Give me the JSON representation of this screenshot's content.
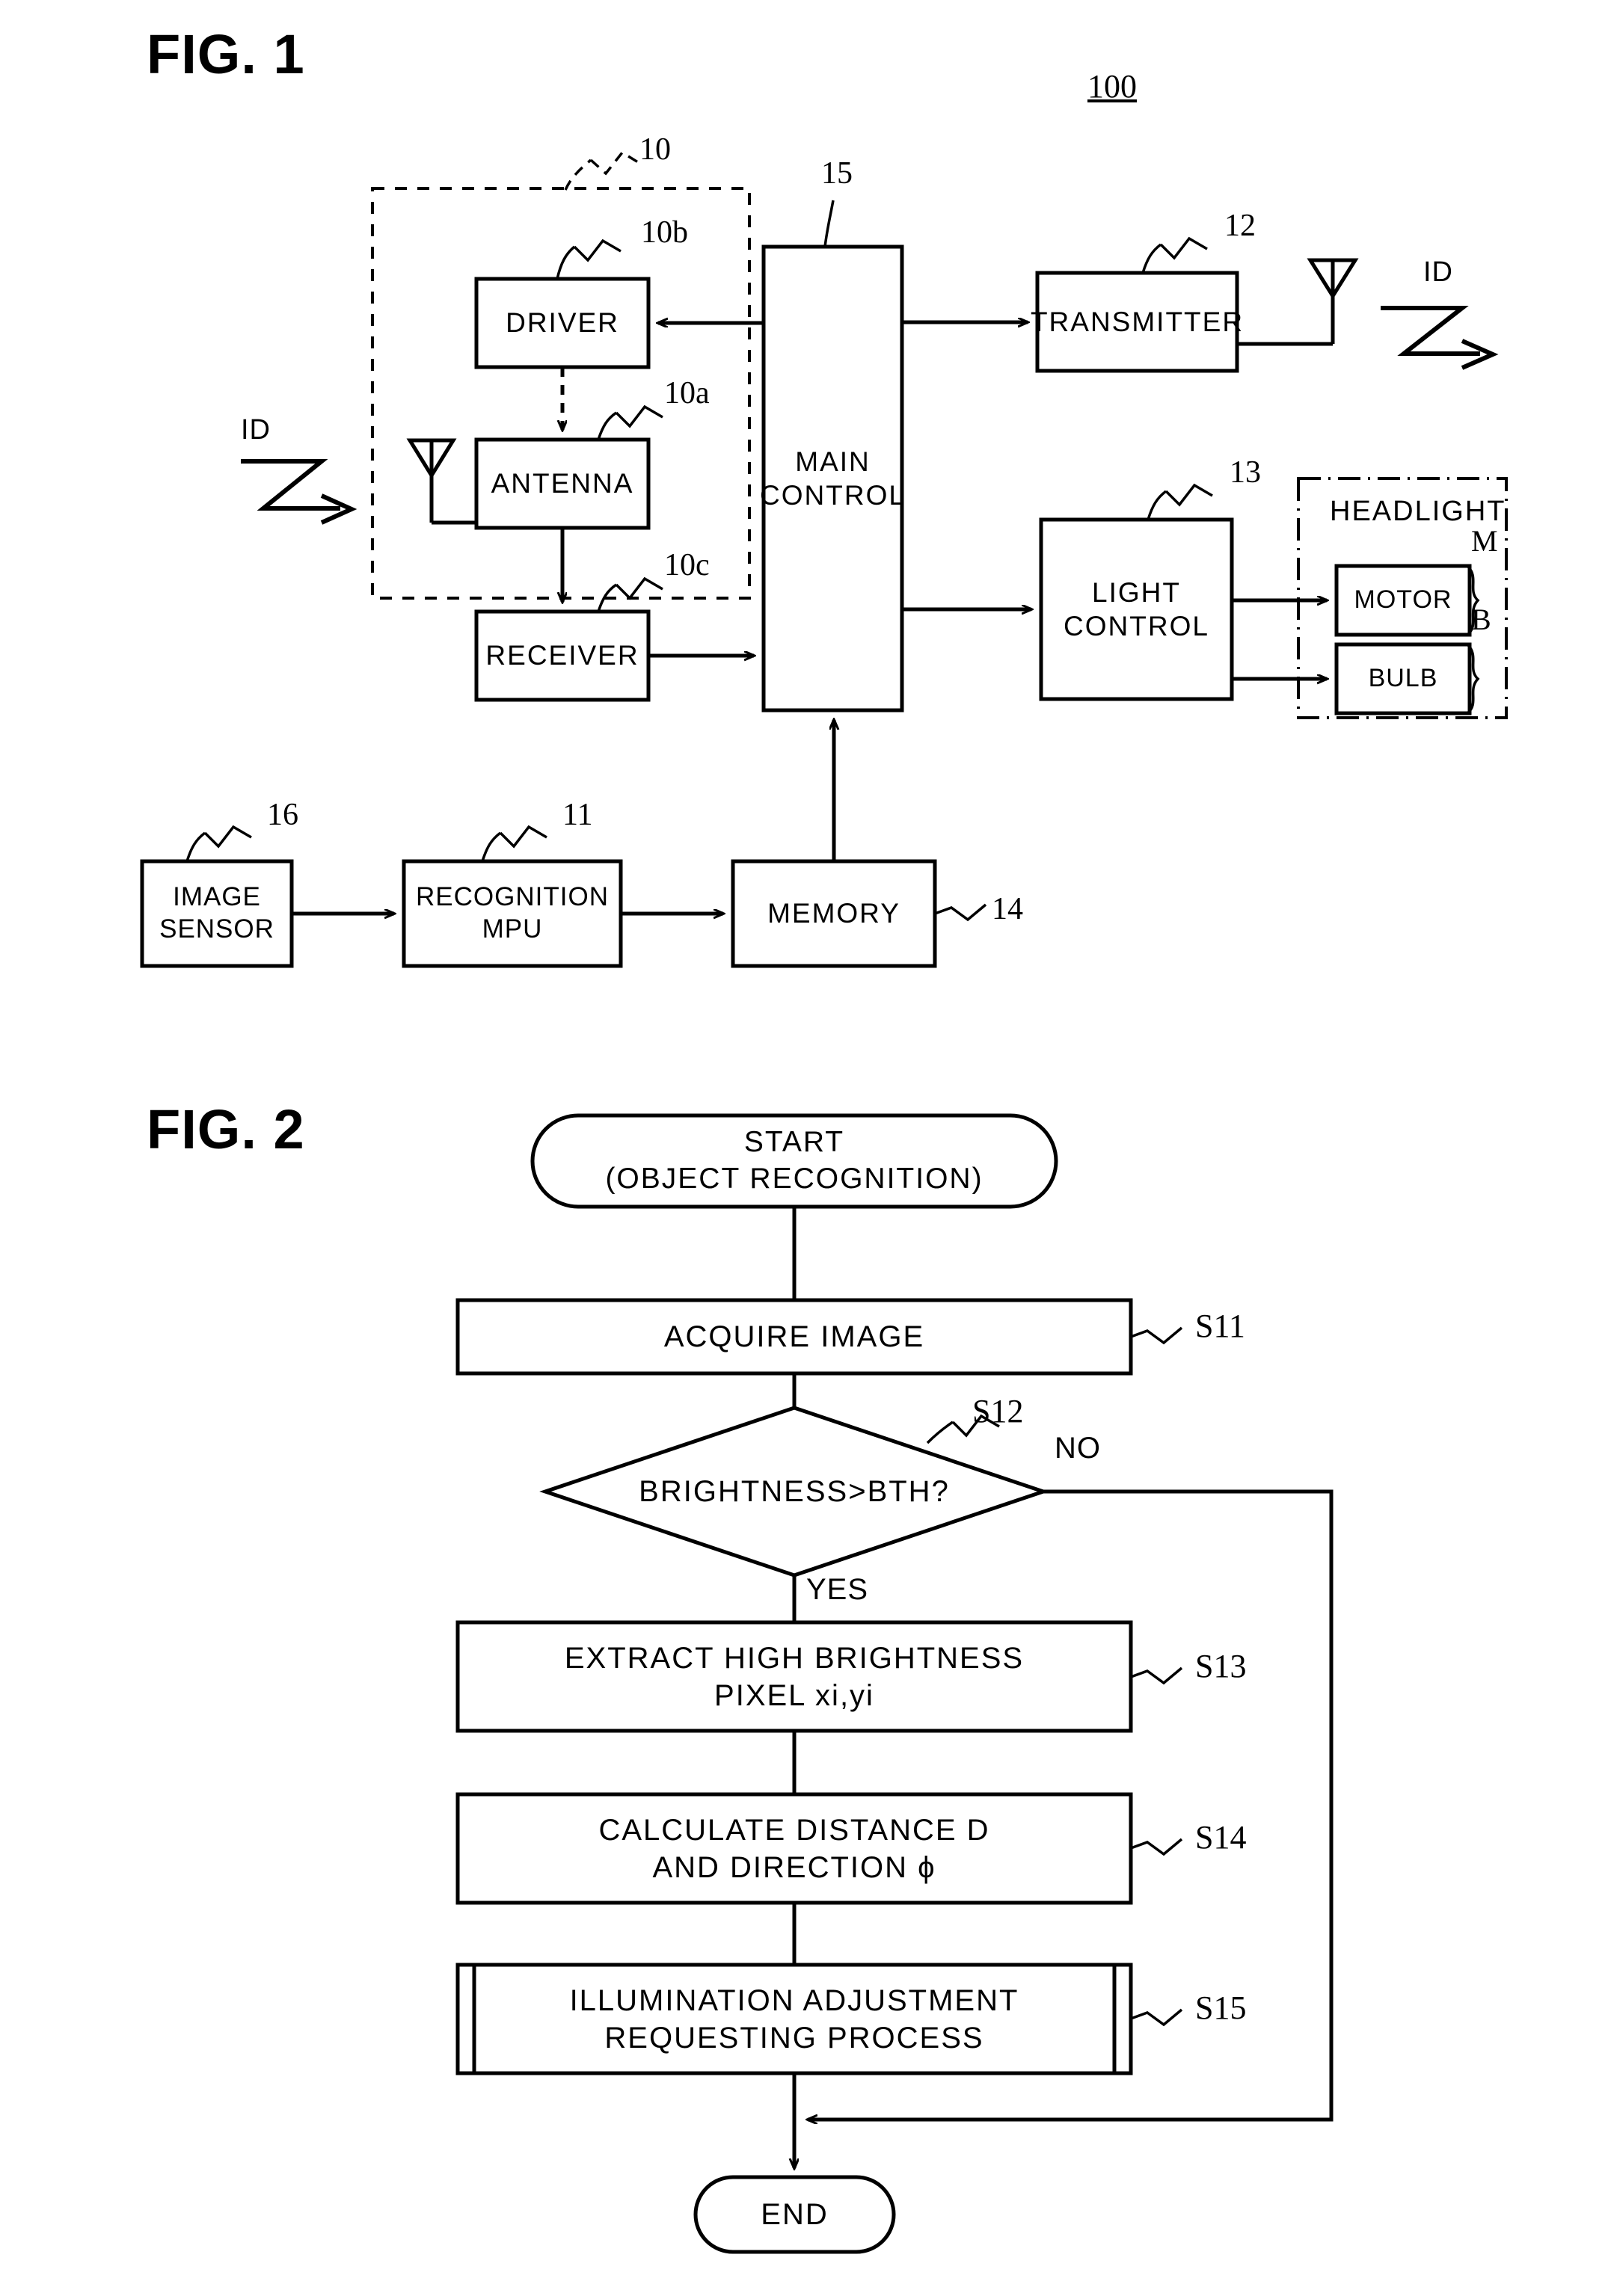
{
  "figures": [
    {
      "id": "fig1",
      "title": "FIG. 1"
    },
    {
      "id": "fig2",
      "title": "FIG. 2"
    }
  ],
  "fig1": {
    "title": "FIG. 1",
    "system_number": "100",
    "blocks": {
      "driver": {
        "label": "DRIVER",
        "ref": "10b"
      },
      "antenna": {
        "label": "ANTENNA",
        "ref": "10a"
      },
      "receiver": {
        "label": "RECEIVER",
        "ref": "10c"
      },
      "main_control": {
        "label": "MAIN\nCONTROL",
        "ref": "15"
      },
      "transmitter": {
        "label": "TRANSMITTER",
        "ref": "12"
      },
      "light_control": {
        "label": "LIGHT\nCONTROL",
        "ref": "13"
      },
      "motor": {
        "label": "MOTOR",
        "ref": "M"
      },
      "bulb": {
        "label": "BULB",
        "ref": "B"
      },
      "image_sensor": {
        "label": "IMAGE\nSENSOR",
        "ref": "16"
      },
      "recognition_mpu": {
        "label": "RECOGNITION\nMPU",
        "ref": "11"
      },
      "memory": {
        "label": "MEMORY",
        "ref": "14"
      }
    },
    "groups": {
      "transceiver_unit": {
        "ref": "10"
      },
      "headlight": {
        "label": "HEADLIGHT"
      }
    },
    "signals": {
      "id_in": "ID",
      "id_out": "ID"
    }
  },
  "fig2": {
    "title": "FIG. 2",
    "nodes": [
      {
        "key": "start",
        "shape": "terminator",
        "label": "START\n(OBJECT RECOGNITION)",
        "step": ""
      },
      {
        "key": "s11",
        "shape": "process",
        "label": "ACQUIRE IMAGE",
        "step": "S11"
      },
      {
        "key": "s12",
        "shape": "decision",
        "label": "BRIGHTNESS>BTH?",
        "step": "S12"
      },
      {
        "key": "s13",
        "shape": "process",
        "label": "EXTRACT HIGH BRIGHTNESS\nPIXEL xi,yi",
        "step": "S13"
      },
      {
        "key": "s14",
        "shape": "process",
        "label": "CALCULATE DISTANCE D\nAND DIRECTION ϕ",
        "step": "S14"
      },
      {
        "key": "s15",
        "shape": "predefined-process",
        "label": "ILLUMINATION ADJUSTMENT\nREQUESTING PROCESS",
        "step": "S15"
      },
      {
        "key": "end",
        "shape": "terminator",
        "label": "END",
        "step": ""
      }
    ],
    "branch_labels": {
      "yes": "YES",
      "no": "NO"
    }
  },
  "colors": {
    "ink": "#000000",
    "paper": "#ffffff"
  }
}
